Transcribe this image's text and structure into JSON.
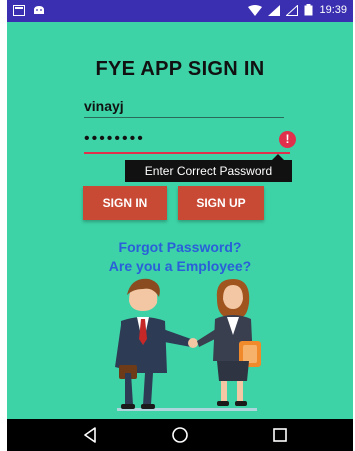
{
  "status_bar": {
    "time": "19:39",
    "bg_color": "#3a2fb0"
  },
  "screen": {
    "background": "#3dd3a6",
    "title": "FYE APP SIGN IN",
    "username": {
      "value": "vinayj"
    },
    "password": {
      "value": "••••••••"
    },
    "password_error": {
      "icon": "!",
      "message": "Enter Correct Password"
    },
    "buttons": {
      "sign_in": "SIGN IN",
      "sign_up": "SIGN UP",
      "color": "#c84a35"
    },
    "links": {
      "forgot_password": "Forgot Password?",
      "employee": "Are you a Employee?"
    }
  },
  "nav_bar": {
    "icons": [
      "back-icon",
      "home-icon",
      "recent-apps-icon"
    ]
  }
}
